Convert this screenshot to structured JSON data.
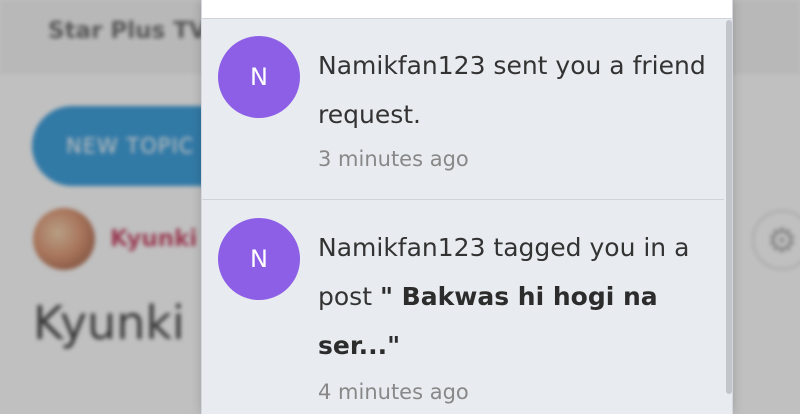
{
  "background": {
    "breadcrumb": "Star Plus TV",
    "new_topic_button": "NEW TOPIC",
    "author_name": "Kyunki",
    "topic_title": "Kyunki",
    "settings_icon": "gear-icon"
  },
  "notifications": [
    {
      "avatar_letter": "N",
      "avatar_color": "#8c5fe6",
      "text": "Namikfan123 sent you a friend request.",
      "time": "3 minutes ago"
    },
    {
      "avatar_letter": "N",
      "avatar_color": "#8c5fe6",
      "text_prefix": "Namikfan123 tagged you in a post",
      "post_title": "\" Bakwas hi hogi na ser...\"",
      "time": "4 minutes ago"
    }
  ]
}
